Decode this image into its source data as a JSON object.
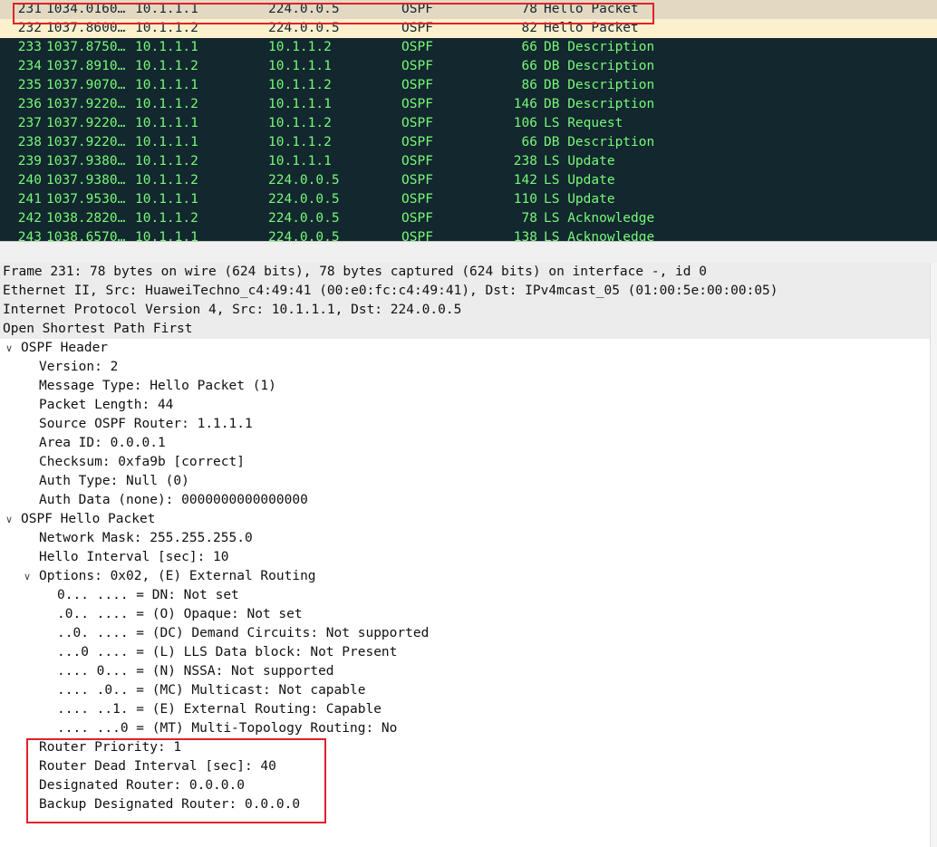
{
  "packet_list": {
    "rows": [
      {
        "no": "231",
        "time": "1034.0160…",
        "src": "10.1.1.1",
        "dst": "224.0.0.5",
        "proto": "OSPF",
        "len": "78",
        "info": "Hello Packet",
        "state": "selected"
      },
      {
        "no": "232",
        "time": "1037.8600…",
        "src": "10.1.1.2",
        "dst": "224.0.0.5",
        "proto": "OSPF",
        "len": "82",
        "info": "Hello Packet",
        "state": "secondary"
      },
      {
        "no": "233",
        "time": "1037.8750…",
        "src": "10.1.1.1",
        "dst": "10.1.1.2",
        "proto": "OSPF",
        "len": "66",
        "info": "DB Description",
        "state": "normal"
      },
      {
        "no": "234",
        "time": "1037.8910…",
        "src": "10.1.1.2",
        "dst": "10.1.1.1",
        "proto": "OSPF",
        "len": "66",
        "info": "DB Description",
        "state": "normal"
      },
      {
        "no": "235",
        "time": "1037.9070…",
        "src": "10.1.1.1",
        "dst": "10.1.1.2",
        "proto": "OSPF",
        "len": "86",
        "info": "DB Description",
        "state": "normal"
      },
      {
        "no": "236",
        "time": "1037.9220…",
        "src": "10.1.1.2",
        "dst": "10.1.1.1",
        "proto": "OSPF",
        "len": "146",
        "info": "DB Description",
        "state": "normal"
      },
      {
        "no": "237",
        "time": "1037.9220…",
        "src": "10.1.1.1",
        "dst": "10.1.1.2",
        "proto": "OSPF",
        "len": "106",
        "info": "LS Request",
        "state": "normal"
      },
      {
        "no": "238",
        "time": "1037.9220…",
        "src": "10.1.1.1",
        "dst": "10.1.1.2",
        "proto": "OSPF",
        "len": "66",
        "info": "DB Description",
        "state": "normal"
      },
      {
        "no": "239",
        "time": "1037.9380…",
        "src": "10.1.1.2",
        "dst": "10.1.1.1",
        "proto": "OSPF",
        "len": "238",
        "info": "LS Update",
        "state": "normal"
      },
      {
        "no": "240",
        "time": "1037.9380…",
        "src": "10.1.1.2",
        "dst": "224.0.0.5",
        "proto": "OSPF",
        "len": "142",
        "info": "LS Update",
        "state": "normal"
      },
      {
        "no": "241",
        "time": "1037.9530…",
        "src": "10.1.1.1",
        "dst": "224.0.0.5",
        "proto": "OSPF",
        "len": "110",
        "info": "LS Update",
        "state": "normal"
      },
      {
        "no": "242",
        "time": "1038.2820…",
        "src": "10.1.1.2",
        "dst": "224.0.0.5",
        "proto": "OSPF",
        "len": "78",
        "info": "LS Acknowledge",
        "state": "normal"
      },
      {
        "no": "243",
        "time": "1038.6570…",
        "src": "10.1.1.1",
        "dst": "224.0.0.5",
        "proto": "OSPF",
        "len": "138",
        "info": "LS Acknowledge",
        "state": "normal"
      }
    ]
  },
  "details": {
    "rows": [
      {
        "indent": 0,
        "toggle": "",
        "style": "summary",
        "text": "Frame 231: 78 bytes on wire (624 bits), 78 bytes captured (624 bits) on interface -, id 0"
      },
      {
        "indent": 0,
        "toggle": "",
        "style": "summary",
        "text": "Ethernet II, Src: HuaweiTechno_c4:49:41 (00:e0:fc:c4:49:41), Dst: IPv4mcast_05 (01:00:5e:00:00:05)"
      },
      {
        "indent": 0,
        "toggle": "",
        "style": "summary",
        "text": "Internet Protocol Version 4, Src: 10.1.1.1, Dst: 224.0.0.5"
      },
      {
        "indent": 0,
        "toggle": "",
        "style": "summary",
        "text": "Open Shortest Path First"
      },
      {
        "indent": 1,
        "toggle": "expanded",
        "style": "normal",
        "text": "OSPF Header"
      },
      {
        "indent": 2,
        "toggle": "",
        "style": "normal",
        "text": "Version: 2"
      },
      {
        "indent": 2,
        "toggle": "",
        "style": "normal",
        "text": "Message Type: Hello Packet (1)"
      },
      {
        "indent": 2,
        "toggle": "",
        "style": "normal",
        "text": "Packet Length: 44"
      },
      {
        "indent": 2,
        "toggle": "",
        "style": "normal",
        "text": "Source OSPF Router: 1.1.1.1"
      },
      {
        "indent": 2,
        "toggle": "",
        "style": "normal",
        "text": "Area ID: 0.0.0.1"
      },
      {
        "indent": 2,
        "toggle": "",
        "style": "normal",
        "text": "Checksum: 0xfa9b [correct]"
      },
      {
        "indent": 2,
        "toggle": "",
        "style": "normal",
        "text": "Auth Type: Null (0)"
      },
      {
        "indent": 2,
        "toggle": "",
        "style": "normal",
        "text": "Auth Data (none): 0000000000000000"
      },
      {
        "indent": 1,
        "toggle": "expanded",
        "style": "normal",
        "text": "OSPF Hello Packet"
      },
      {
        "indent": 2,
        "toggle": "",
        "style": "normal",
        "text": "Network Mask: 255.255.255.0"
      },
      {
        "indent": 2,
        "toggle": "",
        "style": "normal",
        "text": "Hello Interval [sec]: 10"
      },
      {
        "indent": 2,
        "toggle": "expanded",
        "style": "normal",
        "text": "Options: 0x02, (E) External Routing"
      },
      {
        "indent": 3,
        "toggle": "",
        "style": "normal",
        "text": "0... .... = DN: Not set"
      },
      {
        "indent": 3,
        "toggle": "",
        "style": "normal",
        "text": ".0.. .... = (O) Opaque: Not set"
      },
      {
        "indent": 3,
        "toggle": "",
        "style": "normal",
        "text": "..0. .... = (DC) Demand Circuits: Not supported"
      },
      {
        "indent": 3,
        "toggle": "",
        "style": "normal",
        "text": "...0 .... = (L) LLS Data block: Not Present"
      },
      {
        "indent": 3,
        "toggle": "",
        "style": "normal",
        "text": ".... 0... = (N) NSSA: Not supported"
      },
      {
        "indent": 3,
        "toggle": "",
        "style": "normal",
        "text": ".... .0.. = (MC) Multicast: Not capable"
      },
      {
        "indent": 3,
        "toggle": "",
        "style": "normal",
        "text": ".... ..1. = (E) External Routing: Capable"
      },
      {
        "indent": 3,
        "toggle": "",
        "style": "normal",
        "text": ".... ...0 = (MT) Multi-Topology Routing: No"
      },
      {
        "indent": 2,
        "toggle": "",
        "style": "normal",
        "text": "Router Priority: 1"
      },
      {
        "indent": 2,
        "toggle": "",
        "style": "normal",
        "text": "Router Dead Interval [sec]: 40"
      },
      {
        "indent": 2,
        "toggle": "",
        "style": "normal",
        "text": "Designated Router: 0.0.0.0"
      },
      {
        "indent": 2,
        "toggle": "",
        "style": "normal",
        "text": "Backup Designated Router: 0.0.0.0"
      }
    ]
  },
  "icons": {
    "expanded": "chevron-down-icon"
  },
  "colors": {
    "list_bg": "#12272e",
    "list_fg": "#78f878",
    "selected_bg": "#e3d9c2",
    "secondary_bg": "#fdf0cc",
    "annotation": "#e0212a"
  }
}
